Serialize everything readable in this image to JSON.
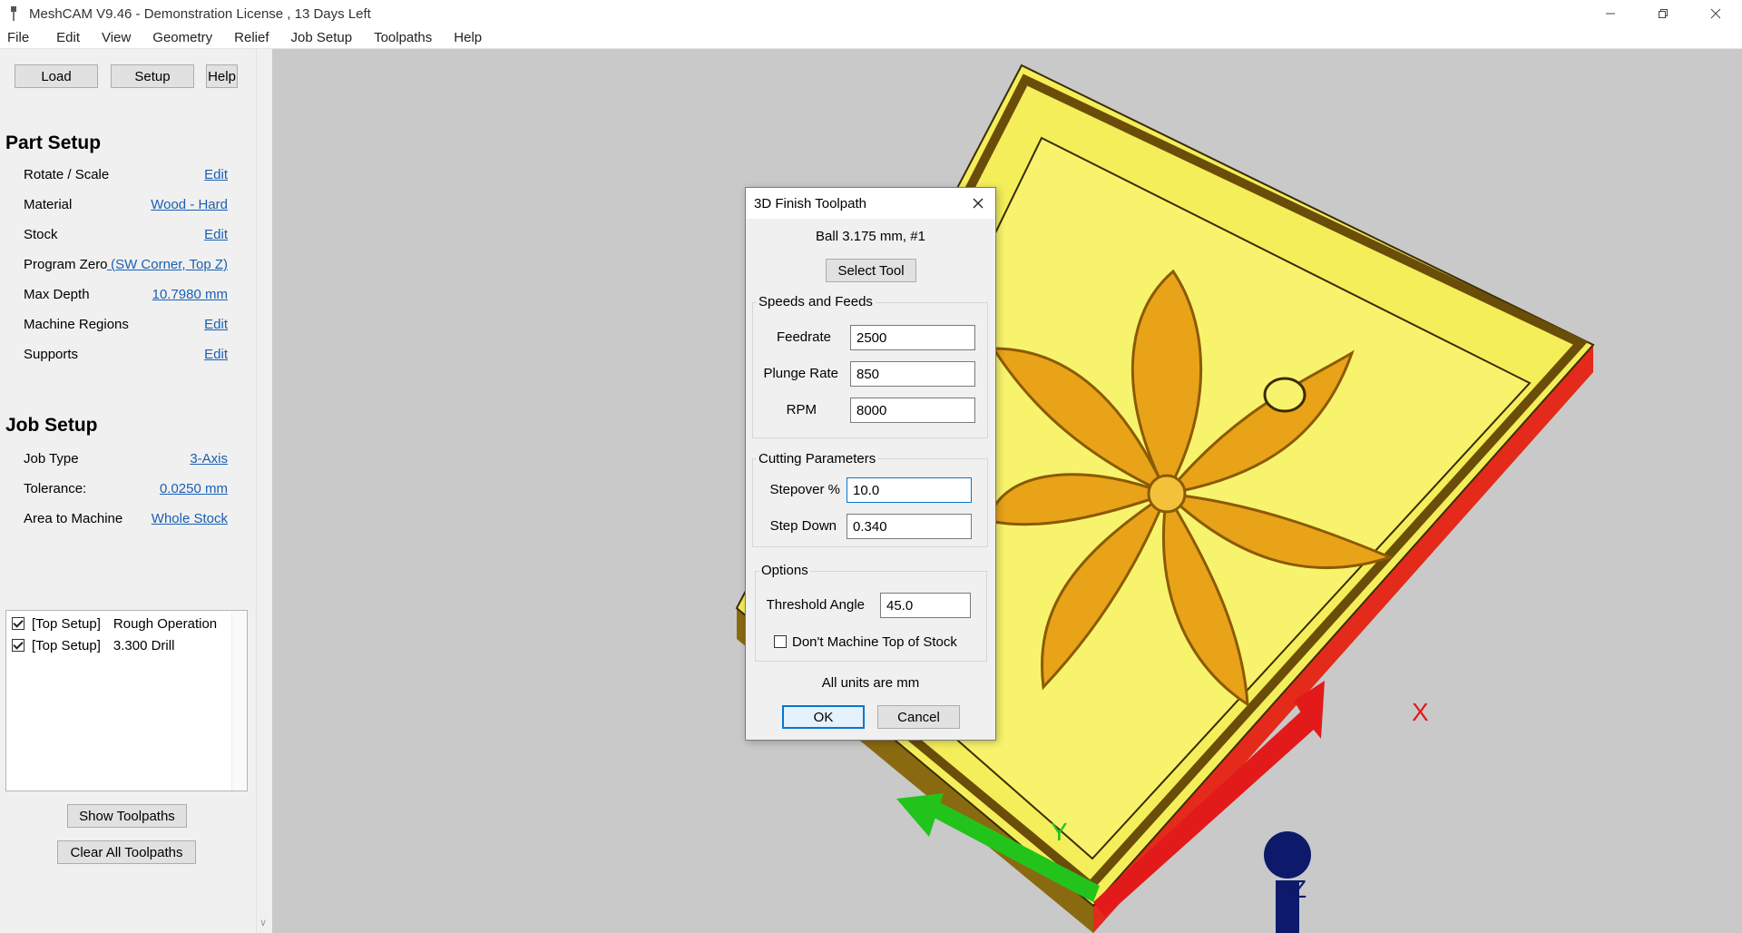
{
  "window": {
    "title": "MeshCAM V9.46 - Demonstration License  , 13 Days Left",
    "icons": [
      "meshcam-app-icon",
      "minimize-icon",
      "restore-icon",
      "close-icon"
    ]
  },
  "menu": [
    "File",
    "Edit",
    "View",
    "Geometry",
    "Relief",
    "Job Setup",
    "Toolpaths",
    "Help"
  ],
  "toolbar": {
    "load": "Load",
    "setup": "Setup",
    "help": "Help"
  },
  "part_setup": {
    "title": "Part Setup",
    "rows": [
      {
        "label": "Rotate / Scale",
        "value": "Edit"
      },
      {
        "label": "Material",
        "value": "Wood - Hard"
      },
      {
        "label": "Stock",
        "value": "Edit"
      },
      {
        "label": "Program Zero",
        "value": " (SW Corner, Top Z)"
      },
      {
        "label": "Max Depth",
        "value": "10.7980 mm"
      },
      {
        "label": "Machine Regions",
        "value": "Edit"
      },
      {
        "label": "Supports",
        "value": "Edit"
      }
    ]
  },
  "job_setup": {
    "title": "Job Setup",
    "rows": [
      {
        "label": "Job Type",
        "value": "3-Axis"
      },
      {
        "label": "Tolerance:",
        "value": "0.0250 mm"
      },
      {
        "label": "Area to Machine",
        "value": "Whole Stock"
      }
    ]
  },
  "operations": [
    {
      "checked": true,
      "setup": "[Top Setup]",
      "name": "Rough Operation"
    },
    {
      "checked": true,
      "setup": "[Top Setup]",
      "name": "3.300 Drill"
    }
  ],
  "bottom_buttons": {
    "show": "Show Toolpaths",
    "clear": "Clear All Toolpaths"
  },
  "viewport": {
    "axis_x": "X",
    "axis_y": "Y",
    "axis_z": "Z",
    "colors": {
      "background": "#c9c9c9",
      "part": "#f5ef5c",
      "flower": "#e8a318",
      "x_axis": "#e21a1a",
      "y_axis": "#22c41c",
      "z_axis": "#0d1a6b"
    }
  },
  "dialog": {
    "title": "3D Finish Toolpath",
    "tool": "Ball 3.175 mm, #1",
    "select_tool": "Select Tool",
    "speeds": {
      "title": "Speeds and Feeds",
      "feedrate_label": "Feedrate",
      "feedrate": "2500",
      "plunge_label": "Plunge Rate",
      "plunge": "850",
      "rpm_label": "RPM",
      "rpm": "8000"
    },
    "cutting": {
      "title": "Cutting Parameters",
      "stepover_label": "Stepover %",
      "stepover": "10.0",
      "stepdown_label": "Step Down",
      "stepdown": "0.340"
    },
    "options": {
      "title": "Options",
      "threshold_label": "Threshold Angle",
      "threshold": "45.0",
      "dont_machine_label": "Don't Machine Top of Stock",
      "dont_machine": false
    },
    "units_note": "All units are mm",
    "ok": "OK",
    "cancel": "Cancel"
  }
}
